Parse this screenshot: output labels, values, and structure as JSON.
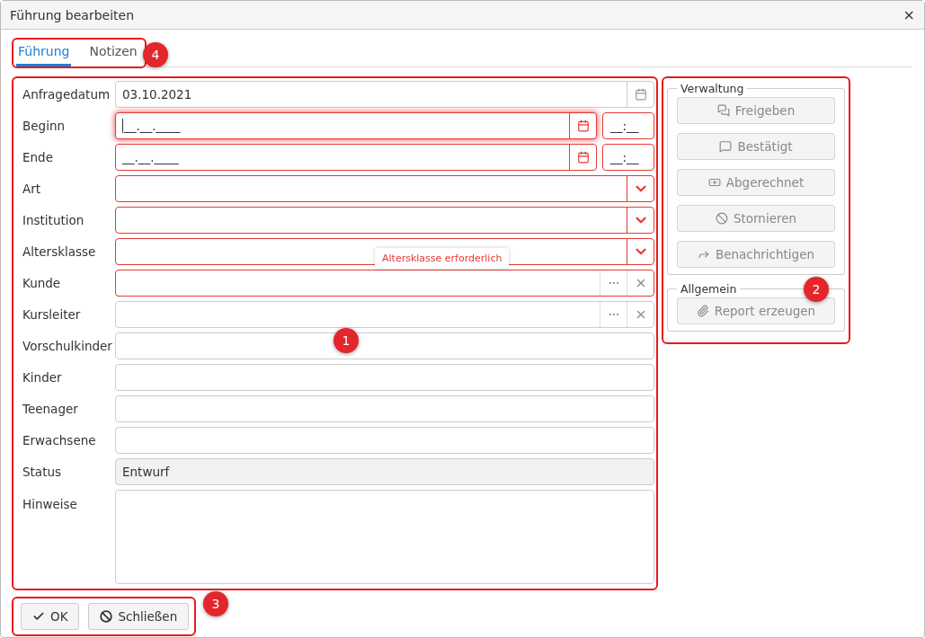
{
  "window": {
    "title": "Führung bearbeiten",
    "close": "×"
  },
  "tabs": [
    {
      "label": "Führung",
      "selected": true
    },
    {
      "label": "Notizen",
      "selected": false
    }
  ],
  "fields": [
    {
      "label": "Anfragedatum",
      "kind": "date",
      "value": "03.10.2021",
      "error": false,
      "focused": false
    },
    {
      "label": "Beginn",
      "kind": "date",
      "value": "__.__.____",
      "time": "__:__",
      "error": true,
      "focused": true
    },
    {
      "label": "Ende",
      "kind": "date",
      "value": "__.__.____",
      "time": "__:__",
      "error": true,
      "focused": false
    },
    {
      "label": "Art",
      "kind": "select",
      "error": true,
      "focused": false
    },
    {
      "label": "Institution",
      "kind": "select",
      "error": true,
      "focused": false
    },
    {
      "label": "Altersklasse",
      "kind": "select",
      "error": true,
      "focused": false,
      "tooltip": "Altersklasse erforderlich"
    },
    {
      "label": "Kunde",
      "kind": "lookup",
      "error": true,
      "focused": false
    },
    {
      "label": "Kursleiter",
      "kind": "lookup",
      "error": false,
      "focused": false
    },
    {
      "label": "Vorschulkinder",
      "kind": "text",
      "error": false,
      "focused": false
    },
    {
      "label": "Kinder",
      "kind": "text",
      "error": false,
      "focused": false
    },
    {
      "label": "Teenager",
      "kind": "text",
      "error": false,
      "focused": false
    },
    {
      "label": "Erwachsene",
      "kind": "text",
      "error": false,
      "focused": false
    },
    {
      "label": "Status",
      "kind": "readonly",
      "value": "Entwurf",
      "error": false,
      "focused": false
    },
    {
      "label": "Hinweise",
      "kind": "textarea",
      "error": false,
      "focused": false
    }
  ],
  "groups": [
    {
      "title": "Verwaltung",
      "buttons": [
        {
          "label": "Freigeben",
          "disabled": true
        },
        {
          "label": "Bestätigt",
          "disabled": true
        },
        {
          "label": "Abgerechnet",
          "disabled": true
        },
        {
          "label": "Stornieren",
          "disabled": true
        },
        {
          "label": "Benachrichtigen",
          "disabled": true
        }
      ]
    },
    {
      "title": "Allgemein",
      "buttons": [
        {
          "label": "Report erzeugen",
          "disabled": true
        }
      ]
    }
  ],
  "footer_buttons": [
    {
      "label": "OK"
    },
    {
      "label": "Schließen"
    }
  ],
  "callouts": [
    "1",
    "2",
    "3",
    "4"
  ]
}
